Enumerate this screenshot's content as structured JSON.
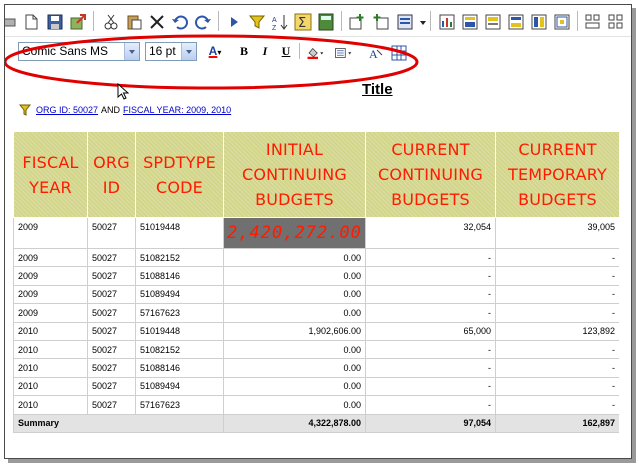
{
  "toolbar1": {
    "icons": [
      "print-icon",
      "new-document-icon",
      "save-icon",
      "export-icon",
      "cut-icon",
      "paste-icon",
      "delete-icon",
      "undo-icon",
      "redo-icon",
      "run-icon",
      "filter-icon",
      "sort-icon",
      "sum-icon",
      "calculator-icon",
      "add-tab-icon",
      "insert-tab-icon",
      "add-report-icon",
      "dropdown-icon",
      "chart-icon",
      "layout-icon-1",
      "layout-icon-2",
      "layout-icon-3",
      "layout-icon-4",
      "layout-icon-5",
      "layout-icon-6",
      "layout-icon-7"
    ]
  },
  "format_toolbar": {
    "font_family": "Comic Sans MS",
    "font_size": "16 pt",
    "bold_label": "B",
    "italic_label": "I",
    "underline_label": "U",
    "font_color_label": "A",
    "highlight_color": "#ff0000",
    "annotation_color": "#e00000"
  },
  "report": {
    "title": "Title",
    "filter": {
      "part1": "ORG ID: 50027",
      "joiner": "AND",
      "part2": "FISCAL YEAR: 2009, 2010"
    }
  },
  "grid": {
    "header_color": "#ff1a00",
    "header_bg": "#d2d58a",
    "columns": [
      {
        "lines": [
          "FISCAL",
          "YEAR"
        ]
      },
      {
        "lines": [
          "ORG",
          "ID"
        ]
      },
      {
        "lines": [
          "SPDTYPE",
          "CODE"
        ]
      },
      {
        "lines": [
          "INITIAL",
          "CONTINUING",
          "BUDGETS"
        ]
      },
      {
        "lines": [
          "CURRENT",
          "CONTINUING",
          "BUDGETS"
        ]
      },
      {
        "lines": [
          "CURRENT",
          "TEMPORARY",
          "BUDGETS"
        ]
      }
    ],
    "rows": [
      [
        "2009",
        "50027",
        "51019448",
        "2,420,272.00",
        "32,054",
        "39,005"
      ],
      [
        "2009",
        "50027",
        "51082152",
        "0.00",
        "-",
        "-"
      ],
      [
        "2009",
        "50027",
        "51088146",
        "0.00",
        "-",
        "-"
      ],
      [
        "2009",
        "50027",
        "51089494",
        "0.00",
        "-",
        "-"
      ],
      [
        "2009",
        "50027",
        "57167623",
        "0.00",
        "-",
        "-"
      ],
      [
        "2010",
        "50027",
        "51019448",
        "1,902,606.00",
        "65,000",
        "123,892"
      ],
      [
        "2010",
        "50027",
        "51082152",
        "0.00",
        "-",
        "-"
      ],
      [
        "2010",
        "50027",
        "51088146",
        "0.00",
        "-",
        "-"
      ],
      [
        "2010",
        "50027",
        "51089494",
        "0.00",
        "-",
        "-"
      ],
      [
        "2010",
        "50027",
        "57167623",
        "0.00",
        "-",
        "-"
      ]
    ],
    "summary": {
      "label": "Summary",
      "initial": "4,322,878.00",
      "current_continuing": "97,054",
      "current_temporary": "162,897"
    }
  }
}
